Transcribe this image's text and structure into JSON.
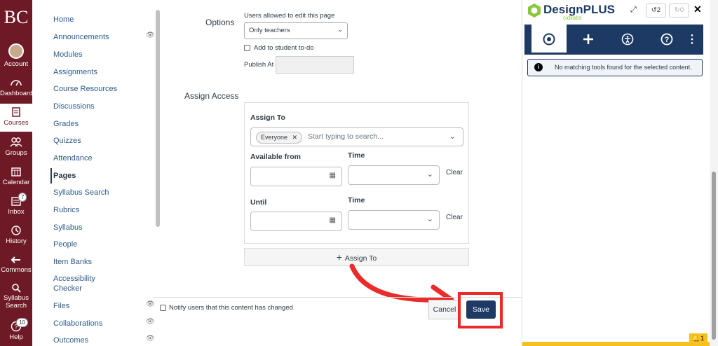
{
  "global_nav": {
    "logo": "BC",
    "items": [
      {
        "label": "Account",
        "icon": "avatar"
      },
      {
        "label": "Dashboard",
        "icon": "dashboard-icon"
      },
      {
        "label": "Courses",
        "icon": "courses-icon"
      },
      {
        "label": "Groups",
        "icon": "groups-icon"
      },
      {
        "label": "Calendar",
        "icon": "calendar-icon"
      },
      {
        "label": "Inbox",
        "icon": "inbox-icon",
        "badge": "7"
      },
      {
        "label": "History",
        "icon": "history-icon"
      },
      {
        "label": "Commons",
        "icon": "commons-icon"
      },
      {
        "label": "Syllabus Search",
        "icon": "search-icon"
      },
      {
        "label": "Help",
        "icon": "help-icon",
        "badge": "10"
      }
    ],
    "bg_color": "#6e1a26"
  },
  "course_nav": {
    "items": [
      {
        "label": "Home"
      },
      {
        "label": "Announcements"
      },
      {
        "label": "Modules"
      },
      {
        "label": "Assignments"
      },
      {
        "label": "Course Resources"
      },
      {
        "label": "Discussions"
      },
      {
        "label": "Grades"
      },
      {
        "label": "Quizzes"
      },
      {
        "label": "Attendance"
      },
      {
        "label": "Pages"
      },
      {
        "label": "Syllabus Search"
      },
      {
        "label": "Rubrics"
      },
      {
        "label": "Syllabus"
      },
      {
        "label": "People"
      },
      {
        "label": "Item Banks"
      },
      {
        "label": "Accessibility Checker"
      },
      {
        "label": "Files"
      },
      {
        "label": "Collaborations"
      },
      {
        "label": "Outcomes"
      }
    ]
  },
  "options": {
    "label": "Options",
    "edit_label": "Users allowed to edit this page",
    "edit_value": "Only teachers",
    "todo_label": "Add to student to-do",
    "publish_label": "Publish At"
  },
  "assign_access": {
    "label": "Assign Access",
    "assign_to_label": "Assign To",
    "chip": "Everyone",
    "placeholder": "Start typing to search...",
    "available_from": "Available from",
    "time1": "Time",
    "clear1": "Clear",
    "until": "Until",
    "time2": "Time",
    "clear2": "Clear",
    "add_button": "Assign To"
  },
  "footer": {
    "notify_label": "Notify users that this content has changed",
    "cancel": "Cancel",
    "save": "Save"
  },
  "designplus": {
    "brand": "DesignPLUS",
    "sub": "cidilabs",
    "undo_count": "2",
    "redo_count": "0",
    "notice": "No matching tools found for the selected content.",
    "bell_count": "1"
  },
  "colors": {
    "accent": "#1d3a64",
    "highlight": "#ea2b2b",
    "warning_bar": "#f6c01f"
  }
}
